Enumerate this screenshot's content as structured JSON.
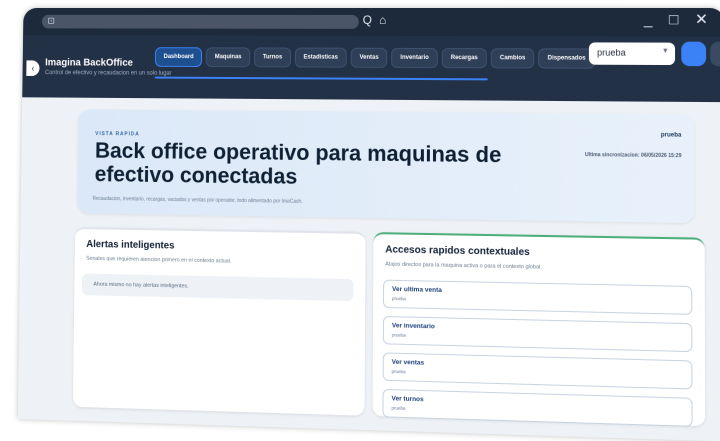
{
  "window": {
    "controls": "_ □ ✕"
  },
  "titlebar": {
    "icons": "Q ⌂"
  },
  "app": {
    "name": "Imagina BackOffice",
    "subtitle": "Control de efectivo y recaudacion en un solo lugar",
    "back_glyph": "‹"
  },
  "nav": {
    "tabs": [
      "Dashboard",
      "Maquinas",
      "Turnos",
      "Estadisticas",
      "Ventas",
      "Inventario",
      "Recargas",
      "Cambios",
      "Dispensados"
    ],
    "active": "Dashboard"
  },
  "machine_select": {
    "value": "prueba",
    "chevron": "▼"
  },
  "hero": {
    "kicker": "VISTA RAPIDA",
    "title": "Back office operativo para maquinas de efectivo conectadas",
    "description": "Recaudacion, inventario, recargas, vaciados y ventas por operador, todo alimentado por ImaCash.",
    "user": "prueba",
    "sync": "Ultima sincronizacion: 06/05/2026 15:29"
  },
  "alerts": {
    "title": "Alertas inteligentes",
    "subtitle": "Senales que requieren atencion primero en el contexto actual.",
    "empty": "Ahora mismo no hay alertas inteligentes."
  },
  "access": {
    "title": "Accesos rapidos contextuales",
    "subtitle": "Atajos directos para la maquina activa o para el contexto global.",
    "items": [
      {
        "label": "Ver ultima venta",
        "meta": "prueba"
      },
      {
        "label": "Ver inventario",
        "meta": "prueba"
      },
      {
        "label": "Ver ventas",
        "meta": "prueba"
      },
      {
        "label": "Ver turnos",
        "meta": "prueba"
      }
    ]
  },
  "colors": {
    "accent": "#3b82f6",
    "appbar": "#233147",
    "success": "#4caf7a"
  }
}
